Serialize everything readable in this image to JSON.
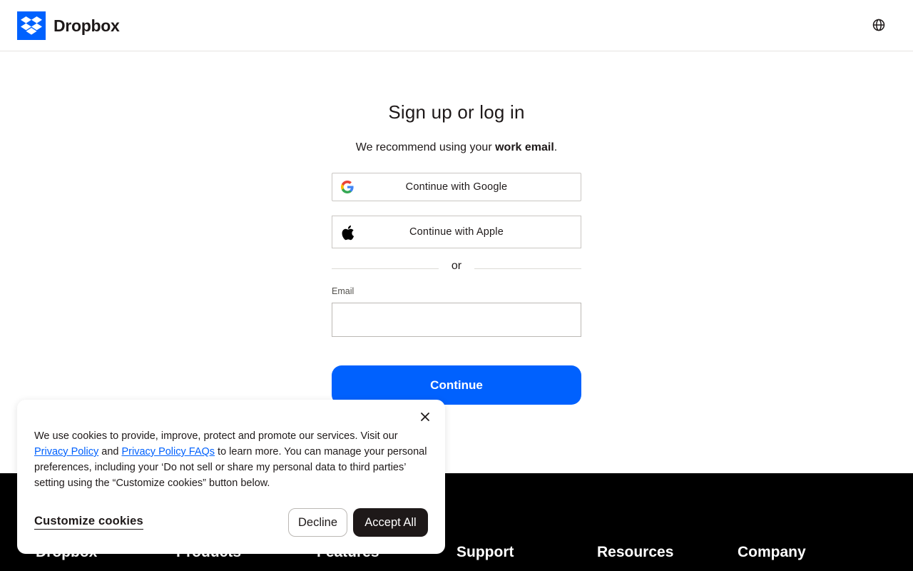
{
  "header": {
    "logo_text": "Dropbox",
    "brand_color": "#0061fe",
    "language_icon": "globe-icon"
  },
  "main": {
    "title": "Sign up or log in",
    "subtitle_prefix": "We recommend using your ",
    "subtitle_bold": "work email",
    "subtitle_suffix": ".",
    "google_label": "Continue with Google",
    "apple_label": "Continue with Apple",
    "divider_text": "or",
    "email_label": "Email",
    "email_value": "",
    "continue_label": "Continue"
  },
  "footer": {
    "columns": [
      "Dropbox",
      "Products",
      "Features",
      "Support",
      "Resources",
      "Company"
    ]
  },
  "cookie_banner": {
    "text_1": "We use cookies to provide, improve, protect and promote our services. Visit our ",
    "link_1": "Privacy Policy",
    "text_2": " and ",
    "link_2": "Privacy Policy FAQs",
    "text_3": " to learn more. You can manage your personal preferences, including your ‘Do not sell or share my personal data to third parties’ setting using the “Customize cookies” button below.",
    "customize_label": "Customize cookies",
    "decline_label": "Decline",
    "accept_label": "Accept All"
  }
}
